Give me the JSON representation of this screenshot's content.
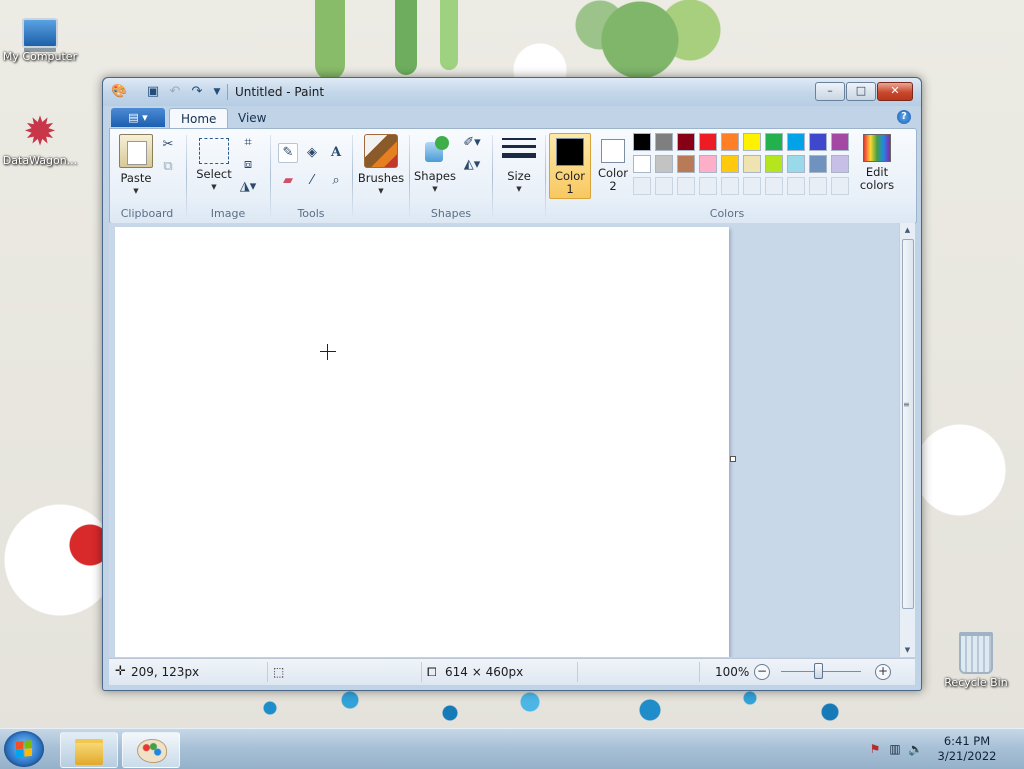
{
  "desktop": {
    "icons": [
      {
        "label": "My Computer"
      },
      {
        "label": "DataWagon..."
      },
      {
        "label": "Recycle Bin"
      }
    ]
  },
  "window": {
    "title": "Untitled - Paint",
    "caption_buttons": {
      "minimize": "–",
      "maximize": "□",
      "close": "✕"
    }
  },
  "ribbon": {
    "tabs": [
      {
        "label": "Home",
        "active": true
      },
      {
        "label": "View",
        "active": false
      }
    ],
    "groups": {
      "clipboard": {
        "label": "Clipboard",
        "paste": "Paste"
      },
      "image": {
        "label": "Image",
        "select": "Select"
      },
      "tools": {
        "label": "Tools"
      },
      "brushes": {
        "label": "Brushes"
      },
      "shapes": {
        "label": "Shapes",
        "shapes_btn": "Shapes"
      },
      "size": {
        "label": "Size"
      },
      "colors": {
        "label": "Colors",
        "color1": "Color 1",
        "color2": "Color 2",
        "color1_value": "#000000",
        "color2_value": "#ffffff",
        "edit_colors": "Edit colors",
        "palette_row1": [
          "#000000",
          "#7f7f7f",
          "#880015",
          "#ed1c24",
          "#ff7f27",
          "#fff200",
          "#22b14c",
          "#00a2e8",
          "#3f48cc",
          "#a349a4"
        ],
        "palette_row2": [
          "#ffffff",
          "#c3c3c3",
          "#b97a57",
          "#ffaec9",
          "#ffc90e",
          "#efe4b0",
          "#b5e61d",
          "#99d9ea",
          "#7092be",
          "#c8bfe7"
        ]
      }
    }
  },
  "statusbar": {
    "cursor_pos": "209, 123px",
    "image_size": "614 × 460px",
    "zoom": "100%",
    "zoom_level": 1.0
  },
  "taskbar": {
    "time": "6:41 PM",
    "date": "3/21/2022"
  },
  "icons": {
    "save": "save-icon",
    "undo": "undo-icon",
    "redo": "redo-icon",
    "cut": "scissors-icon",
    "copy": "copy-icon",
    "crop": "crop-icon",
    "resize": "resize-icon",
    "rotate": "rotate-icon",
    "pencil": "pencil-icon",
    "fill": "fill-bucket-icon",
    "text": "text-icon",
    "eraser": "eraser-icon",
    "picker": "color-picker-icon",
    "magnifier": "magnifier-icon"
  }
}
